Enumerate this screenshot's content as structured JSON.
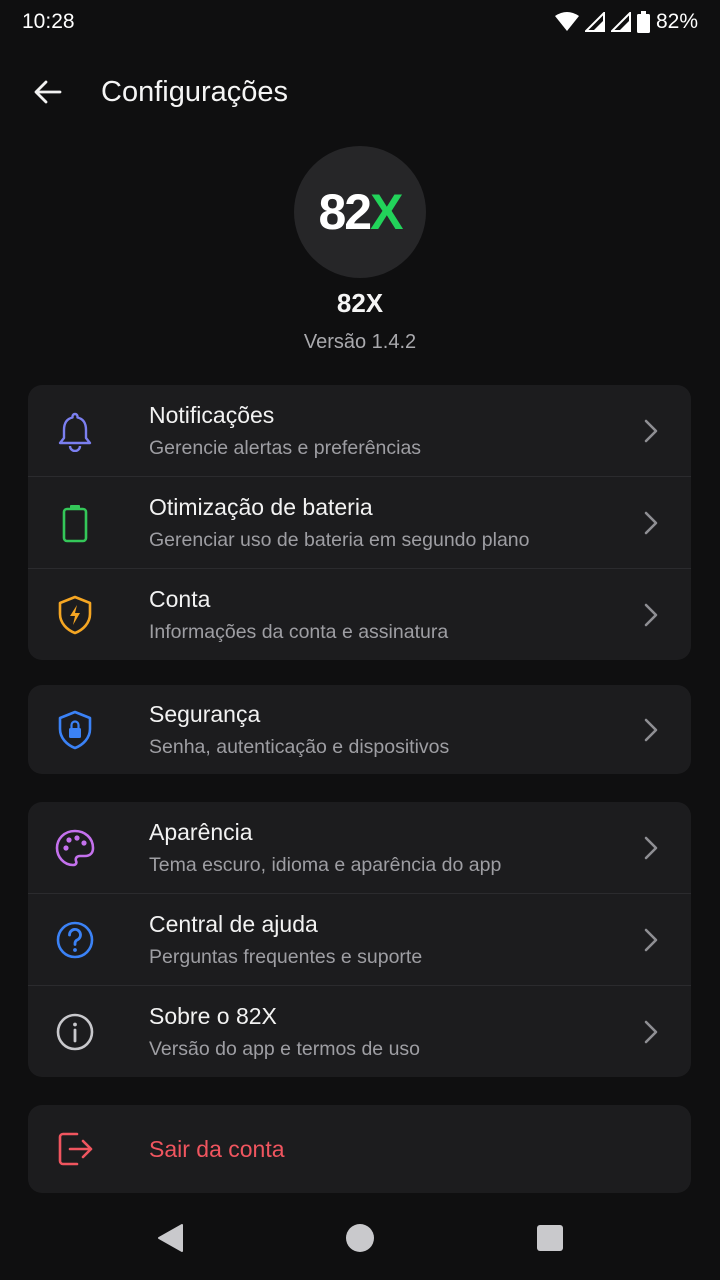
{
  "status_bar": {
    "time": "10:28",
    "battery": "82%"
  },
  "app_bar": {
    "title": "Configurações"
  },
  "header": {
    "logo_number": "82",
    "logo_letter": "X",
    "app_name": "82X",
    "version": "Versão 1.4.2"
  },
  "groups": [
    {
      "items": [
        {
          "title": "Notificações",
          "subtitle": "Gerencie alertas e preferências",
          "icon": "bell-icon",
          "color": "#7b7ff0"
        },
        {
          "title": "Otimização de bateria",
          "subtitle": "Gerenciar uso de bateria em segundo plano",
          "icon": "battery-icon",
          "color": "#34c759"
        },
        {
          "title": "Conta",
          "subtitle": "Informações da conta e assinatura",
          "icon": "shield-bolt-icon",
          "color": "#f5a623"
        }
      ]
    },
    {
      "items": [
        {
          "title": "Segurança",
          "subtitle": "Senha, autenticação e dispositivos",
          "icon": "shield-lock-icon",
          "color": "#3b82f6"
        }
      ]
    },
    {
      "items": [
        {
          "title": "Aparência",
          "subtitle": "Tema escuro, idioma e aparência do app",
          "icon": "palette-icon",
          "color": "#c471ed"
        },
        {
          "title": "Central de ajuda",
          "subtitle": "Perguntas frequentes e suporte",
          "icon": "help-circle-icon",
          "color": "#3b82f6"
        },
        {
          "title": "Sobre o 82X",
          "subtitle": "Versão do app e termos de uso",
          "icon": "info-icon",
          "color": "#c8c8cc"
        }
      ]
    }
  ],
  "logout": {
    "label": "Sair da conta",
    "icon": "logout-icon",
    "color": "#f0555f"
  }
}
